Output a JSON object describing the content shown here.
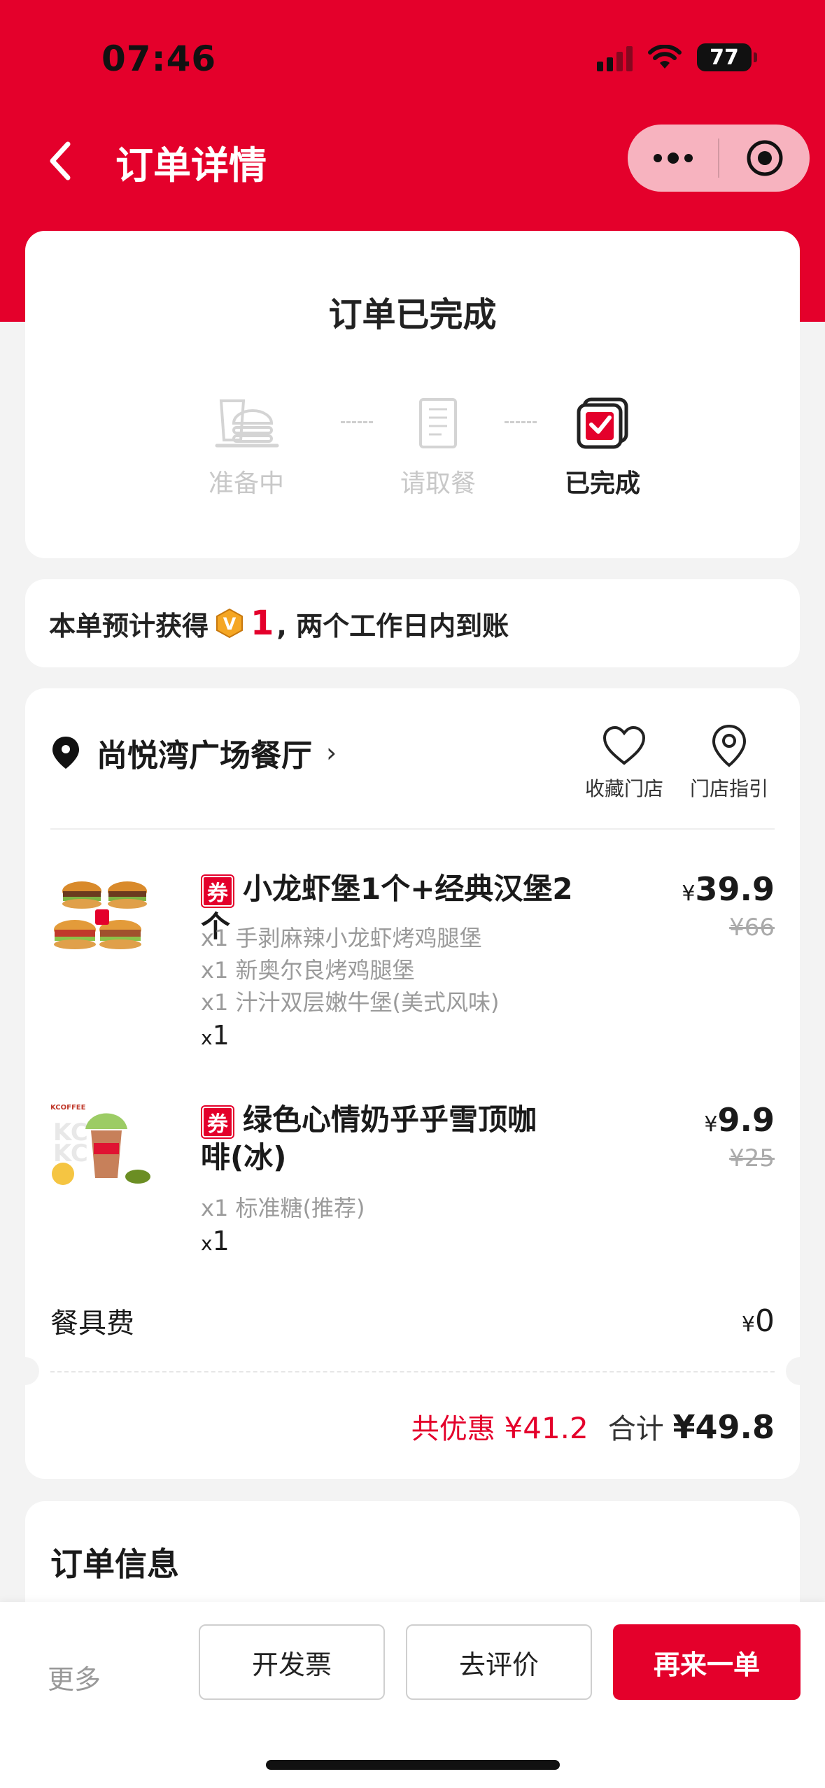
{
  "status_bar": {
    "time": "07:46",
    "battery": "77"
  },
  "nav": {
    "title": "订单详情"
  },
  "order_status": {
    "title": "订单已完成",
    "steps": [
      {
        "label": "准备中",
        "active": false
      },
      {
        "label": "请取餐",
        "active": false
      },
      {
        "label": "已完成",
        "active": true
      }
    ]
  },
  "points": {
    "prefix": "本单预计获得",
    "value": "1",
    "suffix": ", 两个工作日内到账"
  },
  "store": {
    "name": "尚悦湾广场餐厅",
    "actions": {
      "favorite": "收藏门店",
      "guide": "门店指引"
    }
  },
  "items": [
    {
      "coupon_badge": "券",
      "title": "小龙虾堡1个+经典汉堡2个",
      "subitems": [
        "x1 手剥麻辣小龙虾烤鸡腿堡",
        "x1 新奥尔良烤鸡腿堡",
        "x1 汁汁双层嫩牛堡(美式风味)"
      ],
      "qty_prefix": "x",
      "qty": "1",
      "currency": "¥",
      "price": "39.9",
      "original_price": "¥66"
    },
    {
      "coupon_badge": "券",
      "title": "绿色心情奶乎乎雪顶咖啡(冰)",
      "subitems": [
        "x1 标准糖(推荐)"
      ],
      "qty_prefix": "x",
      "qty": "1",
      "currency": "¥",
      "price": "9.9",
      "original_price": "¥25"
    }
  ],
  "fees": {
    "label": "餐具费",
    "currency": "¥",
    "value": "0"
  },
  "totals": {
    "saving_label": "共优惠",
    "saving_value": "¥41.2",
    "total_label": "合计",
    "total_value": "¥49.8"
  },
  "order_info": {
    "title": "订单信息"
  },
  "bottom_bar": {
    "more": "更多",
    "invoice": "开发票",
    "review": "去评价",
    "reorder": "再来一单"
  },
  "colors": {
    "brand_red": "#e4002b",
    "background": "#f3f3f3"
  }
}
